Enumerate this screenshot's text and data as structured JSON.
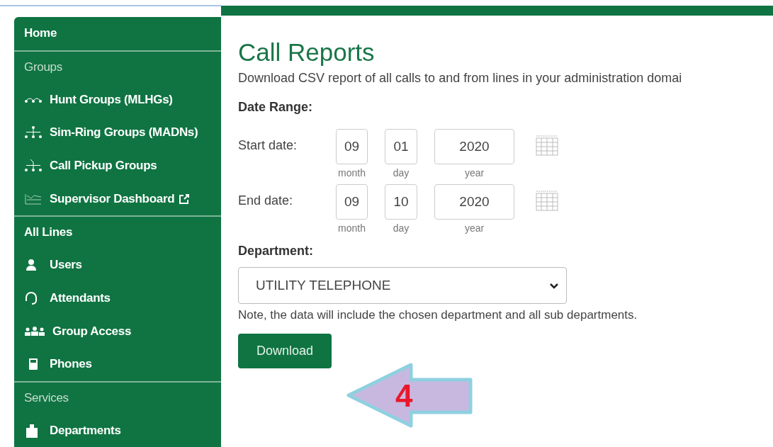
{
  "sidebar": {
    "items": [
      {
        "kind": "heading",
        "label": "Home"
      },
      {
        "kind": "section",
        "label": "Groups"
      },
      {
        "kind": "link",
        "label": "Hunt Groups (MLHGs)"
      },
      {
        "kind": "link",
        "label": "Sim-Ring Groups (MADNs)"
      },
      {
        "kind": "link",
        "label": "Call Pickup Groups"
      },
      {
        "kind": "link",
        "label": "Supervisor Dashboard"
      },
      {
        "kind": "heading",
        "label": "All Lines"
      },
      {
        "kind": "link",
        "label": "Users"
      },
      {
        "kind": "link",
        "label": "Attendants"
      },
      {
        "kind": "link",
        "label": "Group Access"
      },
      {
        "kind": "link",
        "label": "Phones"
      },
      {
        "kind": "section",
        "label": "Services"
      },
      {
        "kind": "link",
        "label": "Departments"
      }
    ]
  },
  "main": {
    "title": "Call Reports",
    "description": "Download CSV report of all calls to and from lines in your administration domai",
    "date_range_label": "Date Range:",
    "dates": [
      {
        "label": "Start date:",
        "month": "09",
        "day": "01",
        "year": "2020",
        "month_caption": "month",
        "day_caption": "day",
        "year_caption": "year"
      },
      {
        "label": "End date:",
        "month": "09",
        "day": "10",
        "year": "2020",
        "month_caption": "month",
        "day_caption": "day",
        "year_caption": "year"
      }
    ],
    "department_label": "Department:",
    "department": "UTILITY TELEPHONE",
    "note": "Note, the data will include the chosen department and all sub departments.",
    "download_button": "Download"
  },
  "callout": {
    "label": "4"
  }
}
